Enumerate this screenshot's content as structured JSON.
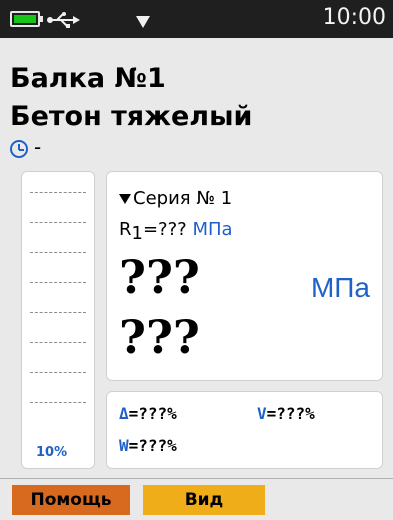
{
  "status": {
    "time": "10:00",
    "battery_color": "#19c419",
    "icons": [
      "battery-icon",
      "usb-icon",
      "signal-icon"
    ]
  },
  "header": {
    "object_name": "Балка №1",
    "material": "Бетон тяжелый",
    "time_value": "-"
  },
  "scale": {
    "percent_label": "10%"
  },
  "measurement": {
    "series_label": "Серия № 1",
    "r1_prefix": "R",
    "r1_sub": "1",
    "r1_value": "=??? ",
    "r1_unit": "МПа",
    "value_main": "???",
    "value_second": "???",
    "unit_big": "МПа"
  },
  "stats": {
    "delta_sym": "Δ",
    "delta_value": "=???%",
    "v_sym": "V",
    "v_value": "=???%",
    "w_sym": "W",
    "w_value": "=???%"
  },
  "softkeys": {
    "help_label": "Помощь",
    "view_label": "Вид",
    "help_color": "#d76a1e",
    "view_color": "#f0ad1a"
  },
  "colors": {
    "accent": "#1f61c8",
    "statusbar": "#1f1f1f",
    "background": "#e9e9e9"
  }
}
